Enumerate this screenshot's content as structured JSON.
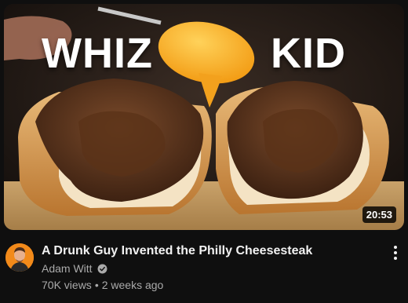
{
  "thumbnail": {
    "overlay_left": "WHIZ",
    "overlay_right": "KID",
    "duration": "20:53"
  },
  "video": {
    "title": "A Drunk Guy Invented the Philly Cheesesteak",
    "channel": "Adam Witt",
    "views": "70K views",
    "separator": "•",
    "age": "2 weeks ago"
  },
  "icons": {
    "verified": "verified-check-icon",
    "more": "more-vertical-icon"
  },
  "colors": {
    "background": "#0f0f0f",
    "title": "#f1f1f1",
    "secondary_text": "#aaaaaa",
    "cheese": "#f7a928",
    "avatar_bg": "#f28a1a"
  }
}
